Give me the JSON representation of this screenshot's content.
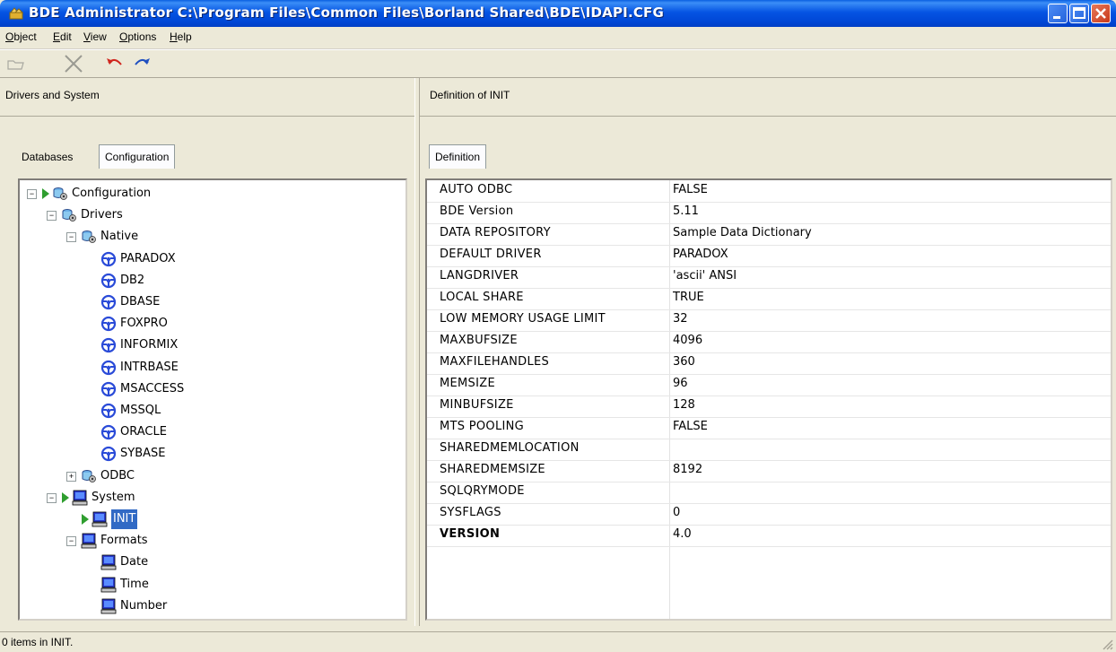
{
  "window": {
    "title": "BDE Administrator  C:\\Program Files\\Common Files\\Borland Shared\\BDE\\IDAPI.CFG"
  },
  "menu": [
    {
      "label": "Object"
    },
    {
      "label": "Edit"
    },
    {
      "label": "View"
    },
    {
      "label": "Options"
    },
    {
      "label": "Help"
    }
  ],
  "toolbar": [
    "open-icon",
    "delete-icon",
    "undo-icon",
    "redo-icon"
  ],
  "left_pane": {
    "caption": "Drivers and System",
    "tabs": [
      "Databases",
      "Configuration"
    ],
    "active_tab": "Configuration",
    "tree": [
      {
        "label": "Configuration",
        "level": 0,
        "icon": "database-config-icon",
        "expand": "−",
        "arrow": true
      },
      {
        "label": "Drivers",
        "level": 1,
        "icon": "database-config-icon",
        "expand": "−"
      },
      {
        "label": "Native",
        "level": 2,
        "icon": "database-config-icon",
        "expand": "−"
      },
      {
        "label": "PARADOX",
        "level": 3,
        "icon": "driver-icon"
      },
      {
        "label": "DB2",
        "level": 3,
        "icon": "driver-icon"
      },
      {
        "label": "DBASE",
        "level": 3,
        "icon": "driver-icon"
      },
      {
        "label": "FOXPRO",
        "level": 3,
        "icon": "driver-icon"
      },
      {
        "label": "INFORMIX",
        "level": 3,
        "icon": "driver-icon"
      },
      {
        "label": "INTRBASE",
        "level": 3,
        "icon": "driver-icon"
      },
      {
        "label": "MSACCESS",
        "level": 3,
        "icon": "driver-icon"
      },
      {
        "label": "MSSQL",
        "level": 3,
        "icon": "driver-icon"
      },
      {
        "label": "ORACLE",
        "level": 3,
        "icon": "driver-icon"
      },
      {
        "label": "SYBASE",
        "level": 3,
        "icon": "driver-icon"
      },
      {
        "label": "ODBC",
        "level": 2,
        "icon": "database-config-icon",
        "expand": "+"
      },
      {
        "label": "System",
        "level": 1,
        "icon": "computer-icon",
        "expand": "−",
        "arrow": true
      },
      {
        "label": "INIT",
        "level": 2,
        "icon": "computer-icon",
        "arrow": true,
        "selected": true
      },
      {
        "label": "Formats",
        "level": 2,
        "icon": "computer-icon",
        "expand": "−"
      },
      {
        "label": "Date",
        "level": 3,
        "icon": "computer-icon"
      },
      {
        "label": "Time",
        "level": 3,
        "icon": "computer-icon"
      },
      {
        "label": "Number",
        "level": 3,
        "icon": "computer-icon"
      }
    ]
  },
  "right_pane": {
    "caption": "Definition of INIT",
    "tabs": [
      "Definition"
    ],
    "rows": [
      {
        "key": "AUTO ODBC",
        "value": "FALSE"
      },
      {
        "key": "BDE Version",
        "value": "5.11"
      },
      {
        "key": "DATA REPOSITORY",
        "value": "Sample Data Dictionary"
      },
      {
        "key": "DEFAULT DRIVER",
        "value": "PARADOX"
      },
      {
        "key": "LANGDRIVER",
        "value": "'ascii' ANSI"
      },
      {
        "key": "LOCAL SHARE",
        "value": "TRUE"
      },
      {
        "key": "LOW MEMORY USAGE LIMIT",
        "value": "32"
      },
      {
        "key": "MAXBUFSIZE",
        "value": "4096"
      },
      {
        "key": "MAXFILEHANDLES",
        "value": "360"
      },
      {
        "key": "MEMSIZE",
        "value": "96"
      },
      {
        "key": "MINBUFSIZE",
        "value": "128"
      },
      {
        "key": "MTS POOLING",
        "value": "FALSE"
      },
      {
        "key": "SHAREDMEMLOCATION",
        "value": ""
      },
      {
        "key": "SHAREDMEMSIZE",
        "value": "8192"
      },
      {
        "key": "SQLQRYMODE",
        "value": ""
      },
      {
        "key": "SYSFLAGS",
        "value": "0"
      },
      {
        "key": "VERSION",
        "value": "4.0",
        "bold": true
      }
    ]
  },
  "status": {
    "text": "0 items in INIT."
  },
  "colors": {
    "titlebar": "#0054e3",
    "selection": "#316ac5",
    "driver_icon": "#2a4bd8",
    "arrow": "#2f9e2f"
  }
}
